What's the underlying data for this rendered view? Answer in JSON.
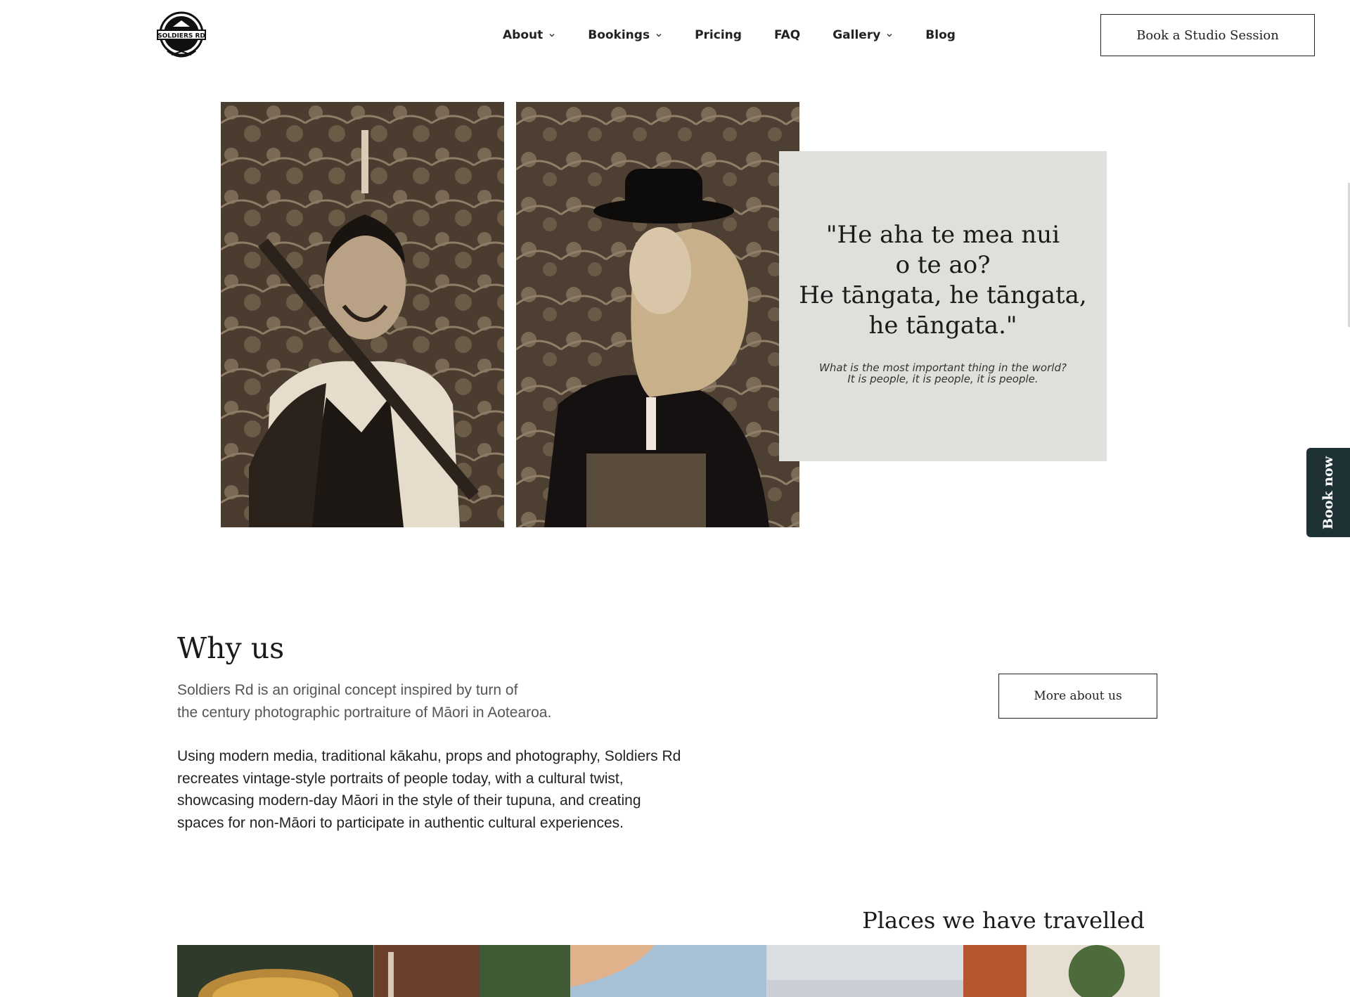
{
  "header": {
    "logo_text": "SOLDIERS RD",
    "logo_icon": "soldiers-rd-badge-logo",
    "nav": [
      {
        "label": "About",
        "has_dropdown": true
      },
      {
        "label": "Bookings",
        "has_dropdown": true
      },
      {
        "label": "Pricing",
        "has_dropdown": false
      },
      {
        "label": "FAQ",
        "has_dropdown": false
      },
      {
        "label": "Gallery",
        "has_dropdown": true
      },
      {
        "label": "Blog",
        "has_dropdown": false
      }
    ],
    "cta_label": "Book a Studio Session"
  },
  "hero": {
    "quote_lines": [
      "\"He aha te mea nui",
      "o te ao?",
      "He tāngata, he tāngata,",
      "he tāngata.\""
    ],
    "translation_lines": [
      "What is the most important thing in the world?",
      "It is people, it is people, it is people."
    ]
  },
  "side_tab": {
    "label": "Book now",
    "color": "#1e3236"
  },
  "why_us": {
    "title": "Why us",
    "intro_lines": [
      "Soldiers Rd is an original concept inspired by turn of",
      "the century photographic portraiture of Māori in Aotearoa."
    ],
    "body_lines": [
      "Using modern media, traditional kākahu, props and photography, Soldiers Rd",
      "recreates vintage-style portraits of people today, with a cultural twist,",
      "showcasing modern-day Māori in the style of their tupuna, and creating",
      "spaces for non-Māori to participate in authentic cultural experiences."
    ],
    "button_label": "More about us"
  },
  "places": {
    "title": "Places we have travelled"
  },
  "colors": {
    "quote_bg": "#dfe0db",
    "accent_dark": "#1e3236",
    "text": "#1a1a1a"
  }
}
